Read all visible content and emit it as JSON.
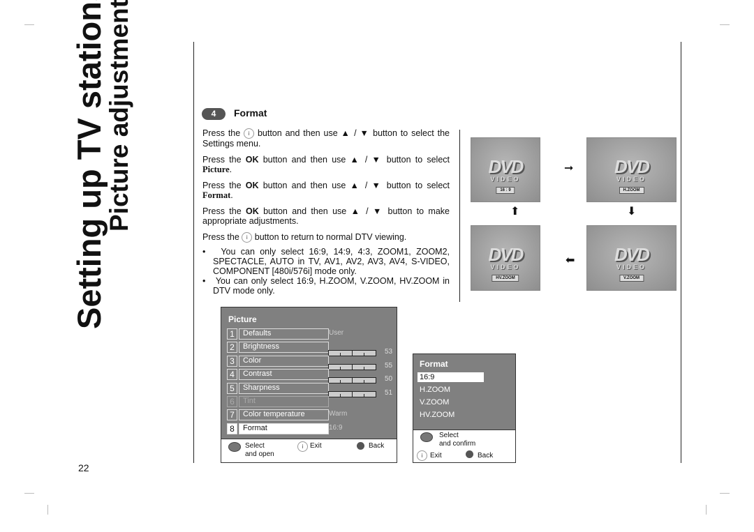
{
  "page": {
    "title": "Setting up TV stations",
    "subtitle": "Picture adjustment",
    "page_number": "22"
  },
  "section": {
    "number": "4",
    "heading": "Format",
    "paragraphs": [
      {
        "a": "Press the",
        "icon": "i",
        "b": "button and then use ▲ / ▼ button to select the Settings menu."
      },
      {
        "a": "Press the",
        "bold": "OK",
        "b": "button and then use ▲ / ▼ button to select",
        "c": "Picture",
        "d": "."
      },
      {
        "a": "Press the",
        "bold": "OK",
        "b": "button and then use ▲ / ▼ button to select",
        "c": "Format",
        "d": "."
      },
      {
        "a": "Press the",
        "bold": "OK",
        "b": "button and then use ▲ / ▼ button to make appropriate adjustments."
      },
      {
        "a": "Press the",
        "icon": "i",
        "b": "button to return to normal DTV viewing."
      }
    ],
    "bullets": [
      "You can only select 16:9, 14:9, 4:3, ZOOM1, ZOOM2, SPECTACLE, AUTO in TV, AV1, AV2, AV3, AV4, S-VIDEO, COMPONENT [480i/576i] mode only.",
      "You can only select 16:9, H.ZOOM, V.ZOOM, HV.ZOOM in DTV mode only."
    ]
  },
  "screens": {
    "logo": "DVD",
    "logo_sub": "VIDEO",
    "labels": [
      "16 : 9",
      "H.ZOOM",
      "V.ZOOM",
      "HV.ZOOM"
    ]
  },
  "picture_menu": {
    "title": "Picture",
    "items": [
      {
        "num": "1",
        "label": "Defaults",
        "value": "User"
      },
      {
        "num": "2",
        "label": "Brightness",
        "value": "53",
        "level": 53
      },
      {
        "num": "3",
        "label": "Color",
        "value": "55",
        "level": 55
      },
      {
        "num": "4",
        "label": "Contrast",
        "value": "50",
        "level": 50
      },
      {
        "num": "5",
        "label": "Sharpness",
        "value": "51",
        "level": 51
      },
      {
        "num": "6",
        "label": "Tint",
        "value": ""
      },
      {
        "num": "7",
        "label": "Color temperature",
        "value": "Warm"
      },
      {
        "num": "8",
        "label": "Format",
        "value": "16:9"
      }
    ],
    "selected_index": 7,
    "footer": {
      "select": "Select",
      "select2": "and open",
      "exit": "Exit",
      "back": "Back"
    }
  },
  "format_menu": {
    "title": "Format",
    "options": [
      "16:9",
      "H.ZOOM",
      "V.ZOOM",
      "HV.ZOOM"
    ],
    "selected_index": 0,
    "footer": {
      "select": "Select",
      "select2": "and confirm",
      "exit": "Exit",
      "back": "Back"
    }
  },
  "colors": {
    "menu_bg": "#808080",
    "highlight": "#ffffff"
  }
}
